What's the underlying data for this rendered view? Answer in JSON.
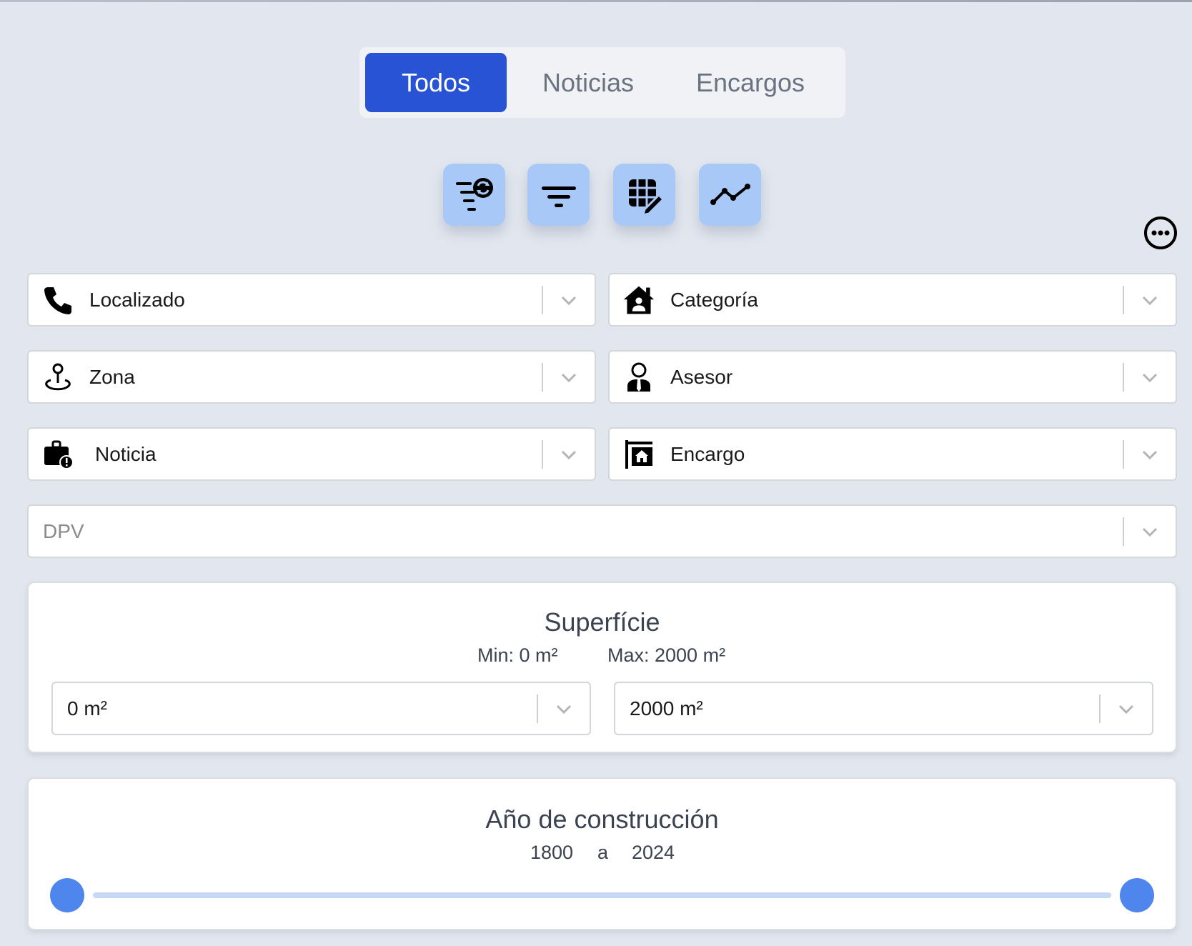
{
  "tabs": [
    {
      "label": "Todos",
      "active": true
    },
    {
      "label": "Noticias",
      "active": false
    },
    {
      "label": "Encargos",
      "active": false
    }
  ],
  "actions": [
    {
      "icon": "filter-refresh-icon"
    },
    {
      "icon": "filter-icon"
    },
    {
      "icon": "table-edit-icon"
    },
    {
      "icon": "line-chart-icon"
    }
  ],
  "more_icon": "more-options-icon",
  "filters": {
    "localizado": {
      "label": "Localizado",
      "icon": "phone-icon"
    },
    "categoria": {
      "label": "Categoría",
      "icon": "house-user-icon"
    },
    "zona": {
      "label": "Zona",
      "icon": "location-pin-icon"
    },
    "asesor": {
      "label": "Asesor",
      "icon": "user-tie-icon"
    },
    "noticia": {
      "label": "Noticia",
      "icon": "briefcase-alert-icon"
    },
    "encargo": {
      "label": "Encargo",
      "icon": "sign-house-icon"
    },
    "dpv": {
      "placeholder": "DPV"
    }
  },
  "superficie": {
    "title": "Superfície",
    "min_label": "Min: 0 m²",
    "max_label": "Max: 2000 m²",
    "min_value": "0 m²",
    "max_value": "2000 m²"
  },
  "anio": {
    "title": "Año de construcción",
    "from": "1800",
    "separator": "a",
    "to": "2024",
    "range_min_fraction": 0,
    "range_max_fraction": 1
  },
  "colors": {
    "accent": "#2953d5",
    "action_bg": "#a8c8f8",
    "slider_thumb": "#4f86ee",
    "slider_track": "#c5d9f5",
    "page_bg": "#e2e7ef"
  }
}
